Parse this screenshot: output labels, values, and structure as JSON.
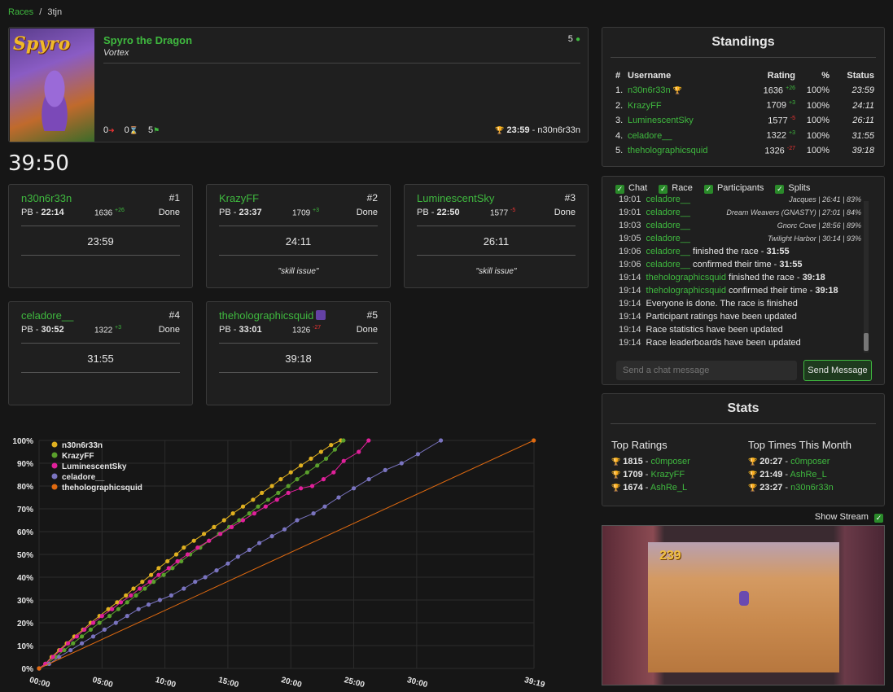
{
  "breadcrumb": {
    "races": "Races",
    "sep": "/",
    "current": "3tjn"
  },
  "game": {
    "title": "Spyro the Dragon",
    "category": "Vortex",
    "cover_text": "Spyro",
    "participants": "5",
    "forfeits": "0",
    "running": "0",
    "finished": "5",
    "best": "23:59",
    "best_by": "n30n6r33n"
  },
  "timer": "39:50",
  "participants": [
    {
      "name": "n30n6r33n",
      "rank": "#1",
      "pb_label": "PB - ",
      "pb": "22:14",
      "rating": "1636",
      "delta": "+26",
      "status": "Done",
      "time": "23:59",
      "comment": ""
    },
    {
      "name": "KrazyFF",
      "rank": "#2",
      "pb_label": "PB - ",
      "pb": "23:37",
      "rating": "1709",
      "delta": "+3",
      "status": "Done",
      "time": "24:11",
      "comment": "\"skill issue\""
    },
    {
      "name": "LuminescentSky",
      "rank": "#3",
      "pb_label": "PB - ",
      "pb": "22:50",
      "rating": "1577",
      "delta": "-5",
      "status": "Done",
      "time": "26:11",
      "comment": "\"skill issue\""
    },
    {
      "name": "celadore__",
      "rank": "#4",
      "pb_label": "PB - ",
      "pb": "30:52",
      "rating": "1322",
      "delta": "+3",
      "status": "Done",
      "time": "31:55",
      "comment": ""
    },
    {
      "name": "theholographicsquid",
      "rank": "#5",
      "pb_label": "PB - ",
      "pb": "33:01",
      "rating": "1326",
      "delta": "-27",
      "status": "Done",
      "time": "39:18",
      "comment": ""
    }
  ],
  "standings": {
    "title": "Standings",
    "headers": {
      "num": "#",
      "user": "Username",
      "rating": "Rating",
      "pct": "%",
      "status": "Status"
    },
    "rows": [
      {
        "num": "1.",
        "user": "n30n6r33n",
        "rating": "1636",
        "delta": "+26",
        "pct": "100%",
        "status": "23:59"
      },
      {
        "num": "2.",
        "user": "KrazyFF",
        "rating": "1709",
        "delta": "+3",
        "pct": "100%",
        "status": "24:11"
      },
      {
        "num": "3.",
        "user": "LuminescentSky",
        "rating": "1577",
        "delta": "-5",
        "pct": "100%",
        "status": "26:11"
      },
      {
        "num": "4.",
        "user": "celadore__",
        "rating": "1322",
        "delta": "+3",
        "pct": "100%",
        "status": "31:55"
      },
      {
        "num": "5.",
        "user": "theholographicsquid",
        "rating": "1326",
        "delta": "-27",
        "pct": "100%",
        "status": "39:18"
      }
    ]
  },
  "chat": {
    "filters": [
      "Chat",
      "Race",
      "Participants",
      "Splits"
    ],
    "placeholder": "Send a chat message",
    "send": "Send Message",
    "lines": [
      {
        "t": "19:01",
        "user": "celadore__",
        "text": "",
        "bold": "",
        "right": "Jacques | 26:41 | 83%"
      },
      {
        "t": "19:01",
        "user": "celadore__",
        "text": "",
        "bold": "",
        "right": "Dream Weavers (GNASTY) | 27:01 | 84%"
      },
      {
        "t": "19:03",
        "user": "celadore__",
        "text": "",
        "bold": "",
        "right": "Gnorc Cove | 28:56 | 89%"
      },
      {
        "t": "19:05",
        "user": "celadore__",
        "text": "",
        "bold": "",
        "right": "Twilight Harbor | 30:14 | 93%"
      },
      {
        "t": "19:06",
        "user": "celadore__",
        "text": " finished the race - ",
        "bold": "31:55",
        "right": ""
      },
      {
        "t": "19:06",
        "user": "celadore__",
        "text": " confirmed their time - ",
        "bold": "31:55",
        "right": ""
      },
      {
        "t": "19:14",
        "user": "theholographicsquid",
        "text": " finished the race - ",
        "bold": "39:18",
        "right": ""
      },
      {
        "t": "19:14",
        "user": "theholographicsquid",
        "text": " confirmed their time - ",
        "bold": "39:18",
        "right": ""
      },
      {
        "t": "19:14",
        "user": "",
        "text": "Everyone is done. The race is finished",
        "bold": "",
        "right": ""
      },
      {
        "t": "19:14",
        "user": "",
        "text": "Participant ratings have been updated",
        "bold": "",
        "right": ""
      },
      {
        "t": "19:14",
        "user": "",
        "text": "Race statistics have been updated",
        "bold": "",
        "right": ""
      },
      {
        "t": "19:14",
        "user": "",
        "text": "Race leaderboards have been updated",
        "bold": "",
        "right": ""
      }
    ]
  },
  "stats": {
    "title": "Stats",
    "top_ratings_title": "Top Ratings",
    "top_times_title": "Top Times This Month",
    "top_ratings": [
      {
        "value": "1815",
        "user": "c0mposer",
        "color": "#f0c040"
      },
      {
        "value": "1709",
        "user": "KrazyFF",
        "color": "#c0c0c0"
      },
      {
        "value": "1674",
        "user": "AshRe_L",
        "color": "#cd7f32"
      }
    ],
    "top_times": [
      {
        "value": "20:27",
        "user": "c0mposer",
        "color": "#f0c040"
      },
      {
        "value": "21:49",
        "user": "AshRe_L",
        "color": "#c0c0c0"
      },
      {
        "value": "23:27",
        "user": "n30n6r33n",
        "color": "#cd7f32"
      }
    ]
  },
  "stream": {
    "label": "Show Stream",
    "hud": "239"
  },
  "colors": {
    "accent": "#3fb93f",
    "gold": "#f0c040",
    "up": "#3fb93f",
    "down": "#e33333"
  },
  "chart_data": {
    "type": "line",
    "x_ticks": [
      "00:00",
      "05:00",
      "10:00",
      "15:00",
      "20:00",
      "25:00",
      "30:00",
      "39:19"
    ],
    "y_ticks": [
      "0%",
      "10%",
      "20%",
      "30%",
      "40%",
      "50%",
      "60%",
      "70%",
      "80%",
      "90%",
      "100%"
    ],
    "xlim_minutes": [
      0,
      39.32
    ],
    "ylim_percent": [
      0,
      100
    ],
    "legend_position": "top-left",
    "series": [
      {
        "name": "n30n6r33n",
        "color": "#e0b020",
        "points": [
          [
            0,
            0
          ],
          [
            0.5,
            2
          ],
          [
            1,
            5
          ],
          [
            1.6,
            8
          ],
          [
            2.2,
            11
          ],
          [
            2.8,
            14
          ],
          [
            3.5,
            17
          ],
          [
            4.1,
            20
          ],
          [
            4.8,
            23
          ],
          [
            5.5,
            26
          ],
          [
            6.2,
            29
          ],
          [
            6.9,
            32
          ],
          [
            7.5,
            35
          ],
          [
            8.2,
            38
          ],
          [
            8.9,
            41
          ],
          [
            9.5,
            44
          ],
          [
            10.2,
            47
          ],
          [
            10.9,
            50
          ],
          [
            11.5,
            53
          ],
          [
            12.3,
            56
          ],
          [
            13.1,
            59
          ],
          [
            13.9,
            62
          ],
          [
            14.7,
            65
          ],
          [
            15.4,
            68
          ],
          [
            16.2,
            71
          ],
          [
            17,
            74
          ],
          [
            17.7,
            77
          ],
          [
            18.5,
            80
          ],
          [
            19.2,
            83
          ],
          [
            20,
            86
          ],
          [
            20.8,
            89
          ],
          [
            21.6,
            92
          ],
          [
            22.4,
            95
          ],
          [
            23.2,
            98
          ],
          [
            23.98,
            100
          ]
        ]
      },
      {
        "name": "KrazyFF",
        "color": "#5aa02c",
        "points": [
          [
            0,
            0
          ],
          [
            0.6,
            2
          ],
          [
            1.3,
            5
          ],
          [
            2,
            8
          ],
          [
            2.7,
            11
          ],
          [
            3.4,
            14
          ],
          [
            4.1,
            17
          ],
          [
            4.8,
            20
          ],
          [
            5.6,
            23
          ],
          [
            6.3,
            26
          ],
          [
            7,
            29
          ],
          [
            7.7,
            32
          ],
          [
            8.4,
            35
          ],
          [
            9.1,
            38
          ],
          [
            9.9,
            41
          ],
          [
            10.6,
            44
          ],
          [
            11.3,
            47
          ],
          [
            12,
            50
          ],
          [
            12.8,
            53
          ],
          [
            13.5,
            56
          ],
          [
            14.3,
            59
          ],
          [
            15.1,
            62
          ],
          [
            15.9,
            65
          ],
          [
            16.7,
            68
          ],
          [
            17.4,
            71
          ],
          [
            18.2,
            74
          ],
          [
            19,
            77
          ],
          [
            19.8,
            80
          ],
          [
            20.5,
            83
          ],
          [
            21.3,
            86
          ],
          [
            22.1,
            89
          ],
          [
            22.8,
            92
          ],
          [
            23.5,
            96
          ],
          [
            24.18,
            100
          ]
        ]
      },
      {
        "name": "LuminescentSky",
        "color": "#e0209a",
        "points": [
          [
            0,
            0
          ],
          [
            0.5,
            2
          ],
          [
            1.1,
            5
          ],
          [
            1.7,
            8
          ],
          [
            2.3,
            11
          ],
          [
            3,
            14
          ],
          [
            3.6,
            17
          ],
          [
            4.3,
            20
          ],
          [
            5,
            23
          ],
          [
            5.8,
            26
          ],
          [
            6.5,
            29
          ],
          [
            7.3,
            32
          ],
          [
            8,
            35
          ],
          [
            8.8,
            38
          ],
          [
            9.5,
            41
          ],
          [
            10.3,
            44
          ],
          [
            11,
            47
          ],
          [
            11.8,
            50
          ],
          [
            12.6,
            53
          ],
          [
            13.5,
            56
          ],
          [
            14.4,
            59
          ],
          [
            15.3,
            62
          ],
          [
            16.2,
            65
          ],
          [
            17.1,
            68
          ],
          [
            18,
            71
          ],
          [
            18.9,
            74
          ],
          [
            19.8,
            77
          ],
          [
            20.8,
            79
          ],
          [
            21.7,
            80
          ],
          [
            22.6,
            83
          ],
          [
            23.4,
            86
          ],
          [
            24.2,
            91
          ],
          [
            25.4,
            95
          ],
          [
            26.18,
            100
          ]
        ]
      },
      {
        "name": "celadore__",
        "color": "#7a74c0",
        "points": [
          [
            0,
            0
          ],
          [
            0.8,
            2
          ],
          [
            1.6,
            5
          ],
          [
            2.5,
            8
          ],
          [
            3.4,
            11
          ],
          [
            4.3,
            14
          ],
          [
            5.2,
            17
          ],
          [
            6.1,
            20
          ],
          [
            7,
            23
          ],
          [
            7.9,
            26
          ],
          [
            8.7,
            28
          ],
          [
            9.6,
            30
          ],
          [
            10.5,
            32
          ],
          [
            11.5,
            35
          ],
          [
            12.4,
            38
          ],
          [
            13.2,
            40
          ],
          [
            14.1,
            43
          ],
          [
            15,
            46
          ],
          [
            15.8,
            49
          ],
          [
            16.7,
            52
          ],
          [
            17.5,
            55
          ],
          [
            18.5,
            58
          ],
          [
            19.5,
            61
          ],
          [
            20.5,
            65
          ],
          [
            21.8,
            68
          ],
          [
            22.7,
            71
          ],
          [
            23.8,
            75
          ],
          [
            25,
            79
          ],
          [
            26.2,
            83
          ],
          [
            27.5,
            87
          ],
          [
            28.8,
            90
          ],
          [
            30.1,
            94
          ],
          [
            31.92,
            100
          ]
        ]
      },
      {
        "name": "theholographicsquid",
        "color": "#e06a10",
        "points": [
          [
            0,
            0
          ],
          [
            39.3,
            100
          ]
        ]
      }
    ]
  }
}
